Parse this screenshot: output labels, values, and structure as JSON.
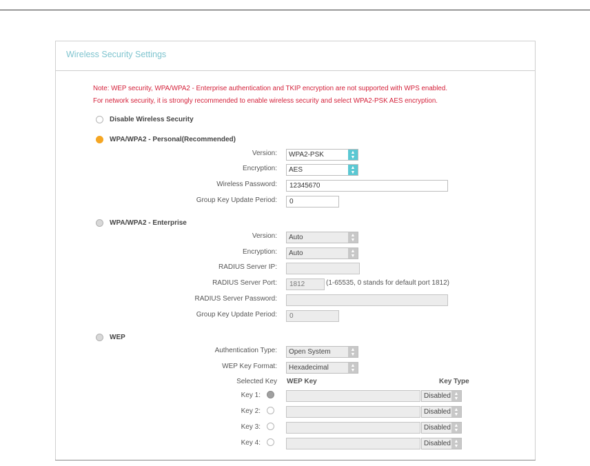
{
  "header": {
    "title": "Wireless Security Settings"
  },
  "notes": [
    "Note: WEP security, WPA/WPA2 - Enterprise authentication and TKIP encryption are not supported with WPS enabled.",
    "For network security, it is strongly recommended to enable wireless security and select WPA2-PSK AES encryption."
  ],
  "disable": {
    "label": "Disable Wireless Security"
  },
  "personal": {
    "label": "WPA/WPA2 - Personal(Recommended)",
    "version_label": "Version:",
    "version_value": "WPA2-PSK",
    "encryption_label": "Encryption:",
    "encryption_value": "AES",
    "password_label": "Wireless Password:",
    "password_value": "12345670",
    "group_key_label": "Group Key Update Period:",
    "group_key_value": "0"
  },
  "enterprise": {
    "label": "WPA/WPA2 - Enterprise",
    "version_label": "Version:",
    "version_value": "Auto",
    "encryption_label": "Encryption:",
    "encryption_value": "Auto",
    "radius_ip_label": "RADIUS Server IP:",
    "radius_ip_value": "",
    "radius_port_label": "RADIUS Server Port:",
    "radius_port_value": "1812",
    "radius_port_hint": "(1-65535, 0 stands for default port 1812)",
    "radius_password_label": "RADIUS Server Password:",
    "radius_password_value": "",
    "group_key_label": "Group Key Update Period:",
    "group_key_value": "0"
  },
  "wep": {
    "label": "WEP",
    "auth_type_label": "Authentication Type:",
    "auth_type_value": "Open System",
    "key_format_label": "WEP Key Format:",
    "key_format_value": "Hexadecimal",
    "selected_key_header": "Selected Key",
    "wep_key_header": "WEP Key",
    "key_type_header": "Key Type",
    "keys": [
      {
        "label": "Key 1:",
        "value": "",
        "type": "Disabled"
      },
      {
        "label": "Key 2:",
        "value": "",
        "type": "Disabled"
      },
      {
        "label": "Key 3:",
        "value": "",
        "type": "Disabled"
      },
      {
        "label": "Key 4:",
        "value": "",
        "type": "Disabled"
      }
    ]
  },
  "colors": {
    "accent": "#5bc8d3",
    "selected_radio": "#f5a623",
    "note_text": "#d4213a",
    "title_text": "#7fc4cf"
  }
}
